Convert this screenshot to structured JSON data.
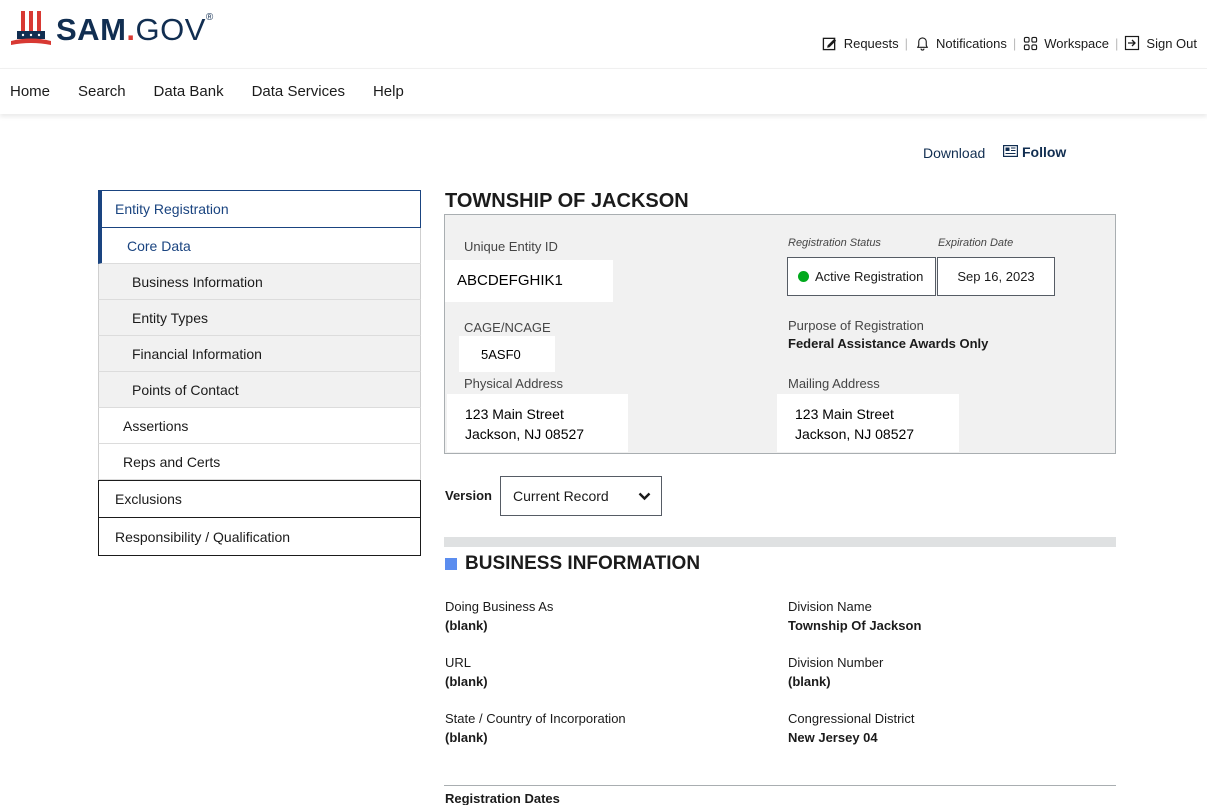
{
  "header": {
    "logo_main": "SAM",
    "logo_dot": ".",
    "logo_gov": "GOV",
    "logo_reg": "®",
    "util_nav": [
      {
        "label": "Requests",
        "icon": "edit-icon"
      },
      {
        "label": "Notifications",
        "icon": "bell-icon"
      },
      {
        "label": "Workspace",
        "icon": "grid-icon"
      },
      {
        "label": "Sign Out",
        "icon": "sign-out-icon"
      }
    ]
  },
  "main_nav": [
    "Home",
    "Search",
    "Data Bank",
    "Data Services",
    "Help"
  ],
  "actions": {
    "download": "Download",
    "follow": "Follow"
  },
  "sidebar": {
    "entity_registration": "Entity Registration",
    "core_data": "Core Data",
    "core_children": [
      "Business Information",
      "Entity Types",
      "Financial Information",
      "Points of Contact"
    ],
    "assertions": "Assertions",
    "reps_certs": "Reps and Certs",
    "exclusions": "Exclusions",
    "responsibility": "Responsibility / Qualification"
  },
  "entity": {
    "title": "TOWNSHIP OF JACKSON",
    "uei_label": "Unique Entity ID",
    "uei_value": "ABCDEFGHIK1",
    "cage_label": "CAGE/NCAGE",
    "cage_value": "5ASF0",
    "reg_status_label": "Registration Status",
    "reg_status_value": "Active Registration",
    "expiration_label": "Expiration Date",
    "expiration_value": "Sep 16, 2023",
    "purpose_label": "Purpose of Registration",
    "purpose_value": "Federal Assistance Awards Only",
    "physical_label": "Physical Address",
    "physical_line1": "123 Main Street",
    "physical_line2": "Jackson, NJ  08527",
    "mailing_label": "Mailing Address",
    "mailing_line1": "123 Main Street",
    "mailing_line2": "Jackson, NJ  08527"
  },
  "version": {
    "label": "Version",
    "selected": "Current Record"
  },
  "business_info": {
    "title": "BUSINESS INFORMATION",
    "dba_label": "Doing Business As",
    "dba_value": "(blank)",
    "url_label": "URL",
    "url_value": "(blank)",
    "state_label": "State / Country of Incorporation",
    "state_value": "(blank)",
    "division_name_label": "Division Name",
    "division_name_value": "Township Of Jackson",
    "division_number_label": "Division Number",
    "division_number_value": "(blank)",
    "cong_label": "Congressional District",
    "cong_value": "New Jersey 04"
  },
  "registration_dates": "Registration Dates",
  "colors": {
    "navy": "#112e51",
    "accent_blue": "#1a4480",
    "active_green": "#00a91c",
    "flag_red": "#d83933",
    "section_square": "#5b8def"
  }
}
